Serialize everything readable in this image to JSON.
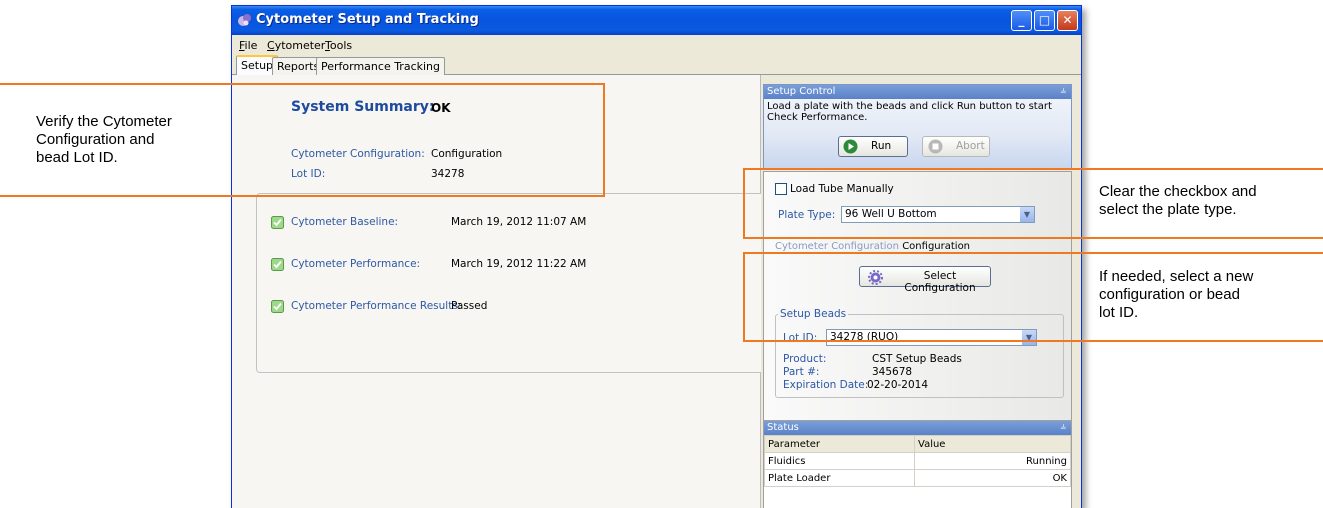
{
  "window": {
    "title": "Cytometer Setup and Tracking",
    "controls": {
      "minimize": "_",
      "maximize": "□",
      "close": "✕"
    }
  },
  "menu": {
    "file": {
      "first": "F",
      "rest": "ile"
    },
    "cytometer": {
      "first": "C",
      "rest": "ytometer"
    },
    "tools": {
      "first": "T",
      "rest": "ools"
    }
  },
  "tabs": [
    "Setup",
    "Reports",
    "Performance Tracking"
  ],
  "summary": {
    "title": "System Summary:",
    "status": "OK",
    "config_label": "Cytometer Configuration:",
    "config_value": "Configuration",
    "lot_label": "Lot ID:",
    "lot_value": "34278"
  },
  "results": [
    {
      "label": "Cytometer Baseline:",
      "value": "March 19, 2012 11:07 AM"
    },
    {
      "label": "Cytometer Performance:",
      "value": "March 19, 2012 11:22 AM"
    },
    {
      "label": "Cytometer Performance Results:",
      "value": "Passed"
    }
  ],
  "setup_control": {
    "header": "Setup Control",
    "instructions": "Load a plate with the beads and click Run button to start Check Performance.",
    "run_label": "Run",
    "abort_label": "Abort",
    "load_manually_label": "Load Tube Manually",
    "plate_type_label": "Plate Type:",
    "plate_type_value": "96 Well U Bottom",
    "config_label": "Cytometer Configuration",
    "config_value": "Configuration",
    "select_config_label": "Select Configuration",
    "beads_group_label": "Setup Beads",
    "lot_label": "Lot ID:",
    "lot_value": "34278 (RUO)",
    "product_label": "Product:",
    "product_value": "CST Setup Beads",
    "part_label": "Part #:",
    "part_value": "345678",
    "expiration_label": "Expiration Date:",
    "expiration_value": "02-20-2014"
  },
  "status": {
    "header": "Status",
    "columns": [
      "Parameter",
      "Value"
    ],
    "rows": [
      [
        "Fluidics",
        "Running"
      ],
      [
        "Plate Loader",
        "OK"
      ]
    ]
  },
  "callouts": {
    "left": [
      "Verify the Cytometer",
      "Configuration and",
      "bead Lot ID."
    ],
    "right_top": [
      "Clear the checkbox and",
      "select the plate type."
    ],
    "right_bottom": [
      "If needed, select a new",
      "configuration or bead",
      "lot ID."
    ]
  },
  "colors": {
    "callout_border": "#f07820",
    "title_bar": "#0854de",
    "label_blue": "#2d58a6"
  }
}
